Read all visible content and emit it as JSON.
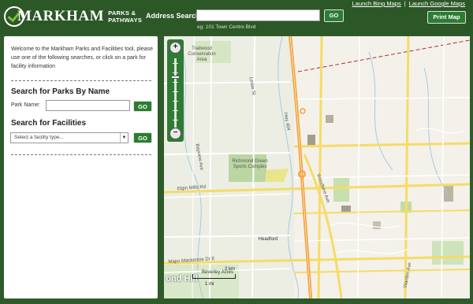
{
  "header": {
    "logo_word": "MARKHAM",
    "logo_sub_line1": "PARKS &",
    "logo_sub_line2": "PATHWAYS",
    "address_label": "Address Search:",
    "address_value": "",
    "address_go": "GO",
    "address_example": "eg: 101 Town Centre Blvd",
    "link_bing": "Launch Bing Maps",
    "link_separator": "|",
    "link_google": "Launch Google Maps",
    "print_button": "Print Map"
  },
  "sidebar": {
    "intro": "Welcome to the Markham Parks and Facilities tool, please use one of the following searches, or click on a park for facility information",
    "parks_title": "Search for Parks By Name",
    "park_label": "Park Name:",
    "park_value": "",
    "park_go": "GO",
    "facilities_title": "Search for Facilities",
    "facility_selected": "Select a facility type...",
    "facility_go": "GO"
  },
  "map": {
    "labels": {
      "trailwood": "Trailwood Conservation Area",
      "richmond": "Richmond Green Sports Complex",
      "headford": "Headford",
      "beverley": "Beverley Acres",
      "richmond_hill": "ond Hill",
      "elgin_mills": "Elgin Mills Rd",
      "hwy404": "Hwy 404",
      "woodbine": "Woodbine Ave",
      "warden": "Warden Ave",
      "leslie": "Leslie St",
      "bayview": "Bayview Ave",
      "major_mackenzie": "Major Mackenzie Dr E"
    },
    "scale_km": "2 km",
    "scale_mi": "1 mi",
    "icons": [
      "zoom-in-icon",
      "zoom-out-icon"
    ]
  },
  "colors": {
    "header_bg": "#2c5727",
    "button_bg": "#2c7c33",
    "highway": "#f4a33c",
    "arterial": "#f5dc66",
    "park": "#b9d5a0"
  }
}
